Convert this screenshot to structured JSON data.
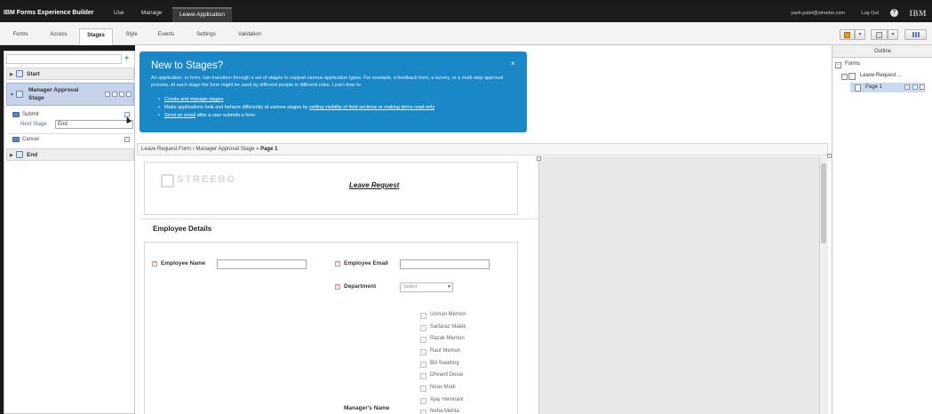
{
  "topbar": {
    "brand": "IBM Forms Experience Builder",
    "nav": [
      "Use",
      "Manage",
      "Leave Application"
    ],
    "user": "yash.patel@streebo.com",
    "logout": "Log Out",
    "help": "?",
    "ibm_logo": "IBM"
  },
  "tabs": [
    "Forms",
    "Access",
    "Stages",
    "Style",
    "Events",
    "Settings",
    "Validation"
  ],
  "active_tab": "Stages",
  "toolbar": {
    "save_icon": "save-icon",
    "preview_icon": "preview-icon",
    "grid_icon": "grid-icon",
    "dropdown_arrow": "▾"
  },
  "stages_panel": {
    "add_icon": "+",
    "stages": [
      {
        "label": "Start"
      },
      {
        "label": "Manager Approval Stage"
      },
      {
        "label": "End"
      }
    ],
    "actions": [
      {
        "label": "Submit",
        "next_stage_label": "Next Stage",
        "next_stage_value": "End"
      },
      {
        "label": "Cancel"
      }
    ]
  },
  "info_box": {
    "title": "New to Stages?",
    "description": "An application, or form, can transition through a set of stages to support various application types. For example, a feedback form, a survey, or a multi-step approval process. At each stage the form might be used by different people in different roles. Learn how to:",
    "bullets": [
      {
        "link": "Create and manage stages",
        "text": ""
      },
      {
        "prefix": "Make applications look and behave differently at various stages by ",
        "link": "setting visibility of field sections or making items read-only"
      },
      {
        "link": "Send an email",
        "text": " after a user submits a form"
      }
    ],
    "close": "×"
  },
  "breadcrumb": {
    "path": "Leave Request Form › Manager Approval Stage » ",
    "current": "Page 1"
  },
  "form": {
    "logo_text": "STREEBO",
    "title": "Leave Request",
    "section_title": "Employee Details",
    "fields": {
      "employee_name": "Employee Name",
      "employee_email": "Employee Email",
      "department": "Department",
      "department_placeholder": "Select",
      "managers_name": "Manager's Name"
    },
    "managers": [
      "Usman Memon",
      "Sarfaraz Malek",
      "Razak Memon",
      "Rauf Memon",
      "Bill Swatting",
      "Dhvanil Desai",
      "Nirav Modi",
      "Ajay Hemnani",
      "Neha Mehta"
    ]
  },
  "outline": {
    "title": "Outline",
    "items": [
      "Forms",
      "Leave Request ...",
      "Page 1"
    ]
  }
}
